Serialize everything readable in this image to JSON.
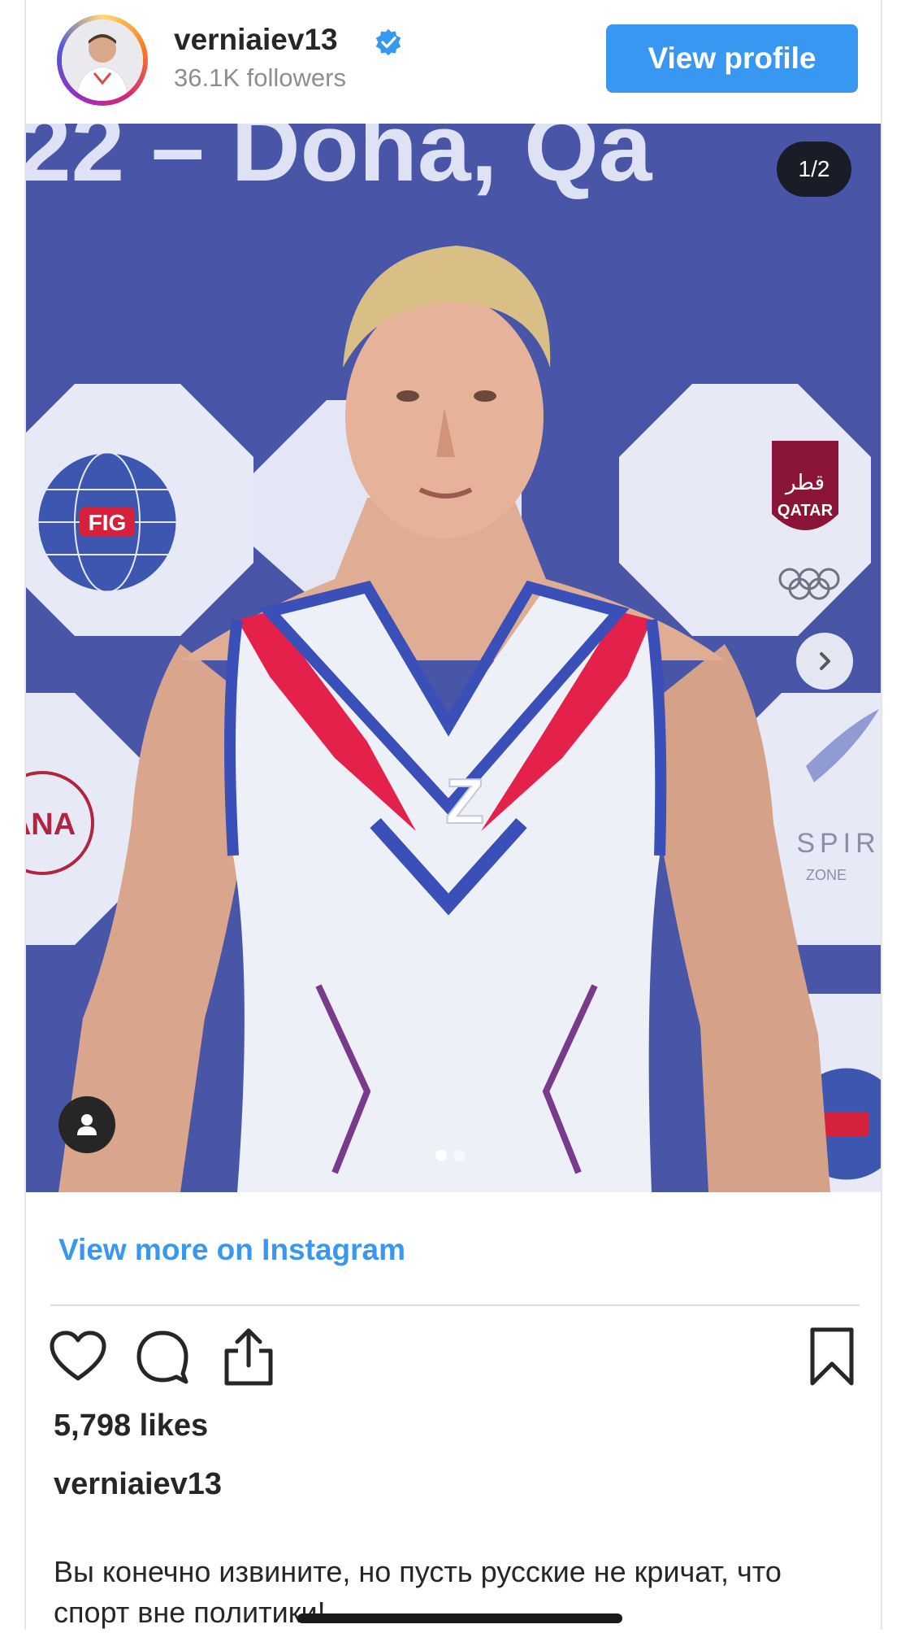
{
  "header": {
    "username": "verniaiev13",
    "followers": "36.1K followers",
    "view_profile_label": "View profile"
  },
  "media": {
    "counter": "1/2",
    "banner_text": "22 – Doha, Qa",
    "sponsor_qatar_arabic": "قطر",
    "sponsor_qatar": "QATAR",
    "sponsor_fig": "FIG",
    "sponsor_ana": "ANA",
    "sponsor_aspire": "SPIR",
    "sponsor_zone": "ZONE",
    "jersey_letter": "Z",
    "page_dots": {
      "count": 2,
      "active": 0
    }
  },
  "links": {
    "view_more": "View more on Instagram"
  },
  "post": {
    "likes": "5,798 likes",
    "caption_user": "verniaiev13",
    "caption_text": "Вы конечно извините, но пусть русские не кричат, что спорт вне политики!"
  },
  "icons": [
    "verified-badge-icon",
    "chevron-right-icon",
    "user-tag-icon",
    "heart-icon",
    "comment-icon",
    "share-icon",
    "bookmark-icon"
  ],
  "colors": {
    "accent": "#3897f0",
    "text": "#262626",
    "muted": "#8e8e8e",
    "banner_blue": "#4956a8",
    "jersey_red": "#e3214a",
    "jersey_blue": "#3a4fb8"
  }
}
